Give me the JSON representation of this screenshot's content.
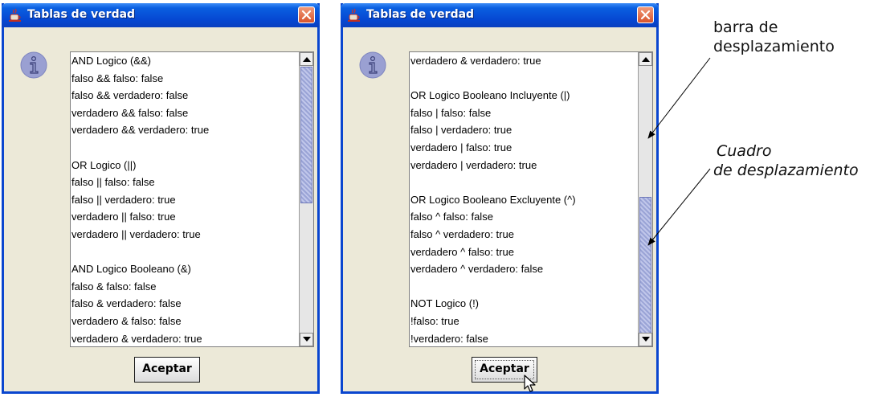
{
  "dialogs": [
    {
      "title": "Tablas de verdad",
      "button_label": "Aceptar",
      "lines": [
        "AND Logico (&&)",
        "falso && falso: false",
        "falso && verdadero: false",
        "verdadero && falso: false",
        "verdadero && verdadero: true",
        "",
        " OR Logico (||)",
        "falso || falso: false",
        "falso || verdadero: true",
        "verdadero || falso: true",
        "verdadero || verdadero: true",
        "",
        "AND Logico Booleano (&)",
        "falso & falso: false",
        "falso & verdadero: false",
        "verdadero & falso: false",
        "verdadero & verdadero: true"
      ]
    },
    {
      "title": "Tablas de verdad",
      "button_label": "Aceptar",
      "lines": [
        "verdadero & verdadero: true",
        "",
        "OR Logico Booleano Incluyente (|)",
        "falso | falso: false",
        "falso | verdadero: true",
        "verdadero | falso: true",
        "verdadero | verdadero: true",
        "",
        "OR Logico Booleano Excluyente (^)",
        "falso ^ falso: false",
        "falso ^ verdadero: true",
        "verdadero ^ falso: true",
        "verdadero ^ verdadero: false",
        "",
        "NOT Logico (!)",
        "!falso: true",
        "!verdadero: false"
      ]
    }
  ],
  "annotations": {
    "scrollbar_label_line1": "barra de",
    "scrollbar_label_line2": "desplazamiento",
    "thumb_label_line1": "Cuadro",
    "thumb_label_line2": "de desplazamiento"
  },
  "icons": {
    "title_icon": "java-cup-icon",
    "close_icon": "close-icon",
    "info_icon": "information-icon",
    "up_arrow": "arrow-up-icon",
    "down_arrow": "arrow-down-icon",
    "cursor": "mouse-pointer-icon"
  },
  "colors": {
    "titlebar": "#0a5fe0",
    "close_button": "#d8532c",
    "window_bg": "#ece9d8",
    "scroll_thumb": "#9aa4d6"
  }
}
